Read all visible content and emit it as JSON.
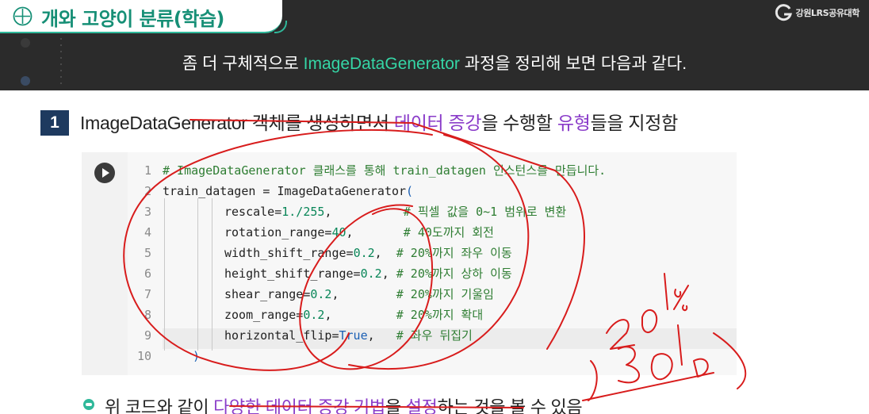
{
  "header": {
    "title": "개와 고양이 분류(학습)",
    "brand": "강원LRS공유대학",
    "subtitle_pre": "좀 더 구체적으로 ",
    "subtitle_accent": "ImageDataGenerator",
    "subtitle_post": " 과정을 정리해 보면 다음과 같다."
  },
  "step": {
    "number": "1",
    "text_pre": "ImageDataGenerator 객체를 생성하면서 ",
    "text_accent1": "데이터 증강",
    "text_mid": "을 수행할 ",
    "text_accent2": "유형",
    "text_post": "들을 지정함"
  },
  "code": {
    "line_numbers": [
      "1",
      "2",
      "3",
      "4",
      "5",
      "6",
      "7",
      "8",
      "9",
      "10"
    ],
    "line1": "# ImageDataGenerator 클래스를 통해 train_datagen 인스턴스를 만듭니다.",
    "line2_pre": "train_datagen = ImageDataGenerator",
    "line2_br": "(",
    "rows": [
      {
        "name": "rescale=",
        "val": "1./255",
        "pad": ",          ",
        "comment": "# 픽셀 값을 0~1 범위로 변환"
      },
      {
        "name": "rotation_range=",
        "val": "40",
        "pad": ",       ",
        "comment": "# 40도까지 회전"
      },
      {
        "name": "width_shift_range=",
        "val": "0.2",
        "pad": ",  ",
        "comment": "# 20%까지 좌우 이동"
      },
      {
        "name": "height_shift_range=",
        "val": "0.2",
        "pad": ", ",
        "comment": "# 20%까지 상하 이동"
      },
      {
        "name": "shear_range=",
        "val": "0.2",
        "pad": ",        ",
        "comment": "# 20%까지 기울임"
      },
      {
        "name": "zoom_range=",
        "val": "0.2",
        "pad": ",         ",
        "comment": "# 20%까지 확대"
      },
      {
        "name": "horizontal_flip=",
        "val": "True",
        "pad": ",   ",
        "comment": "# 좌우 뒤집기"
      }
    ],
    "line10": ")"
  },
  "bullet": {
    "pre": "위 코드와 같이 ",
    "accent1": "다양한 데이터 증강 기법",
    "mid": "을 ",
    "accent2": "설정",
    "post": "하는 것을 볼 수 있음"
  },
  "colors": {
    "header_bg": "#2b2b2b",
    "title_green": "#168f76",
    "accent_green": "#35d6a6",
    "accent_purple": "#8a3cc9",
    "ink_red": "#d81c1c",
    "step_box": "#1e3a5f"
  }
}
